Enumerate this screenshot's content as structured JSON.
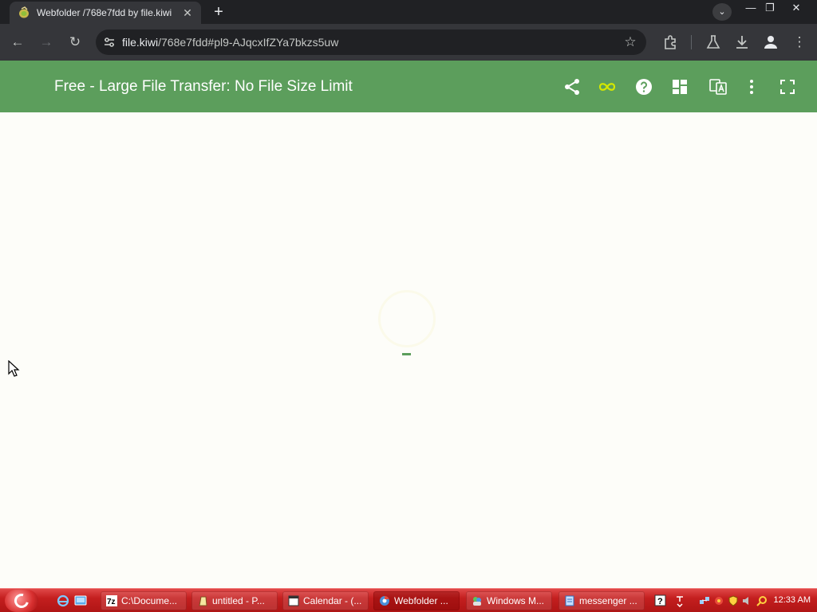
{
  "browser": {
    "tab": {
      "title": "Webfolder /768e7fdd by file.kiwi",
      "close_glyph": "✕",
      "favicon": "kiwi-favicon-icon"
    },
    "new_tab_glyph": "+",
    "tab_search_glyph": "⌄",
    "window_controls": {
      "minimize": "—",
      "restore": "❐",
      "close": "✕"
    },
    "toolbar": {
      "back_glyph": "←",
      "forward_glyph": "→",
      "reload_glyph": "↻",
      "url_host": "file.kiwi",
      "url_rest": "/768e7fdd#pl9-AJqcxIfZYa7bkzs5uw",
      "bookmark_glyph": "☆",
      "menu_glyph": "⋮"
    }
  },
  "app": {
    "title": "Free - Large File Transfer: No File Size Limit",
    "header_icons": [
      "share-icon",
      "infinity-icon",
      "help-icon",
      "dashboard-icon",
      "translate-icon",
      "more-vert-icon",
      "fullscreen-icon"
    ],
    "accent_color": "#5c9e5c",
    "infinity_color": "#d4e800"
  },
  "taskbar": {
    "tasks": [
      {
        "label": "C:\\Docume...",
        "icon": "7zip-icon"
      },
      {
        "label": "untitled - P...",
        "icon": "paint-icon"
      },
      {
        "label": "Calendar - (...",
        "icon": "calendar-icon"
      },
      {
        "label": "Webfolder ...",
        "icon": "chrome-icon",
        "active": true
      },
      {
        "label": "Windows M...",
        "icon": "messenger-icon"
      },
      {
        "label": "messenger ...",
        "icon": "notepad-icon"
      }
    ],
    "clock": "12:33 AM"
  }
}
